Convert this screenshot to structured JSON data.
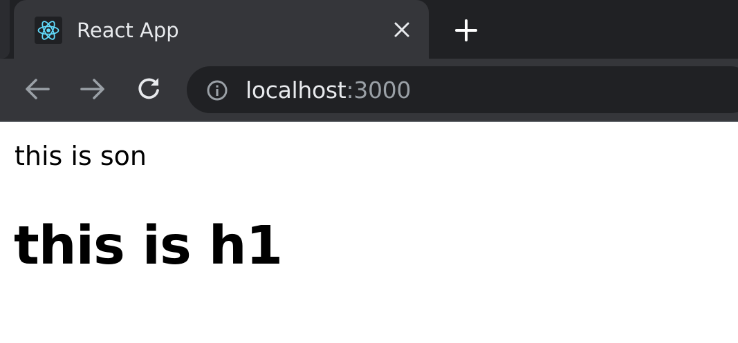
{
  "browser": {
    "tab": {
      "title": "React App",
      "favicon_icon": "react-logo-icon",
      "close_icon": "close-icon"
    },
    "new_tab_icon": "plus-icon",
    "toolbar": {
      "back_icon": "arrow-left-icon",
      "forward_icon": "arrow-right-icon",
      "reload_icon": "reload-icon",
      "site_info_icon": "info-icon",
      "url_host": "localhost",
      "url_port": ":3000"
    },
    "colors": {
      "frame": "#202124",
      "active_tab": "#35363a",
      "omnibox": "#202124",
      "text": "#e8eaed",
      "muted": "#9aa0a6",
      "react_cyan": "#61dafb"
    }
  },
  "page": {
    "paragraph": "this is son",
    "heading": "this is h1"
  }
}
